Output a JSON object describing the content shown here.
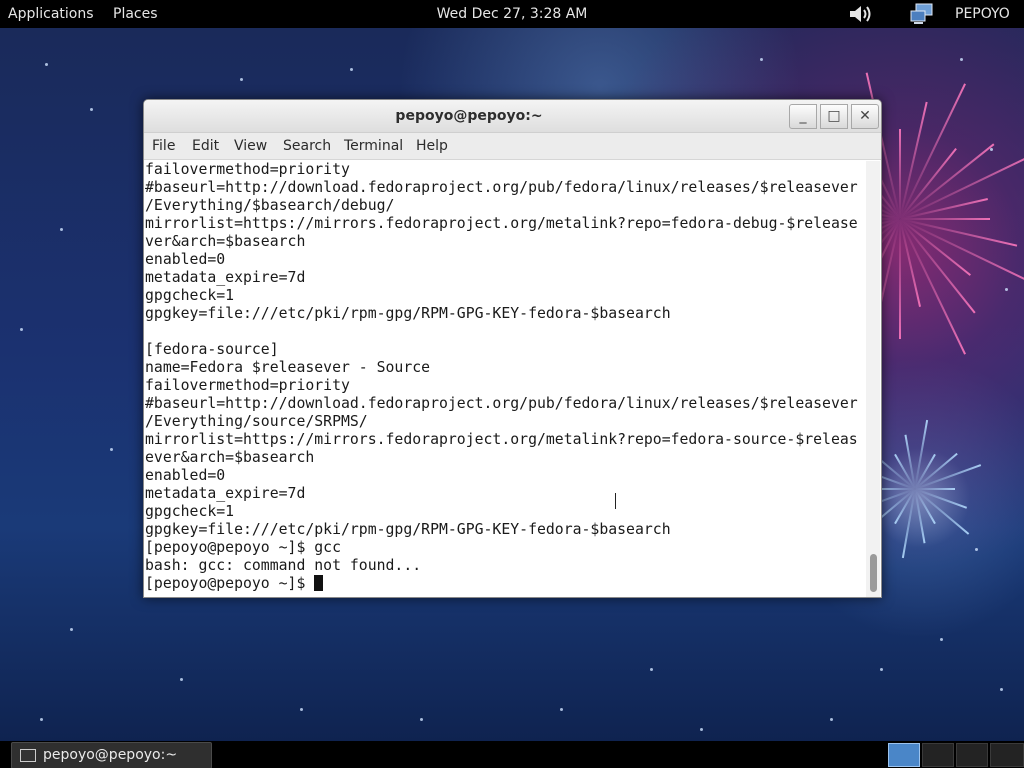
{
  "top_panel": {
    "applications": "Applications",
    "places": "Places",
    "clock": "Wed Dec 27,  3:28 AM",
    "volume_icon": "speaker-icon",
    "network_icon": "network-icon",
    "user": "PEPOYO"
  },
  "window": {
    "title": "pepoyo@pepoyo:~",
    "minimize": "_",
    "maximize": "□",
    "close": "✕",
    "menu": [
      "File",
      "Edit",
      "View",
      "Search",
      "Terminal",
      "Help"
    ]
  },
  "terminal": {
    "lines": [
      "failovermethod=priority",
      "#baseurl=http://download.fedoraproject.org/pub/fedora/linux/releases/$releasever",
      "/Everything/$basearch/debug/",
      "mirrorlist=https://mirrors.fedoraproject.org/metalink?repo=fedora-debug-$release",
      "ver&arch=$basearch",
      "enabled=0",
      "metadata_expire=7d",
      "gpgcheck=1",
      "gpgkey=file:///etc/pki/rpm-gpg/RPM-GPG-KEY-fedora-$basearch",
      "",
      "[fedora-source]",
      "name=Fedora $releasever - Source",
      "failovermethod=priority",
      "#baseurl=http://download.fedoraproject.org/pub/fedora/linux/releases/$releasever",
      "/Everything/source/SRPMS/",
      "mirrorlist=https://mirrors.fedoraproject.org/metalink?repo=fedora-source-$releas",
      "ever&arch=$basearch",
      "enabled=0",
      "metadata_expire=7d",
      "gpgcheck=1",
      "gpgkey=file:///etc/pki/rpm-gpg/RPM-GPG-KEY-fedora-$basearch",
      "[pepoyo@pepoyo ~]$ gcc",
      "bash: gcc: command not found...",
      "[pepoyo@pepoyo ~]$ "
    ]
  },
  "taskbar": {
    "window_button": "pepoyo@pepoyo:~",
    "window_icon": "terminal-icon",
    "workspaces": 4
  }
}
